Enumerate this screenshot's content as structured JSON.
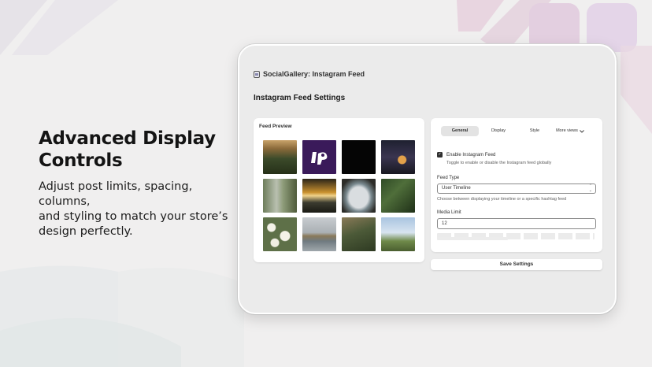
{
  "marketing": {
    "headline_line1": "Advanced Display",
    "headline_line2": "Controls",
    "subcopy_line1": "Adjust post limits, spacing, columns,",
    "subcopy_line2": "and styling to match your store’s",
    "subcopy_line3": "design perfectly."
  },
  "app": {
    "title": "SocialGallery: Instagram Feed",
    "page_title": "Instagram Feed Settings"
  },
  "preview": {
    "label": "Feed Preview",
    "thumbnails": [
      "forest-valley-photo",
      "brand-logo-tile",
      "black-tile",
      "moonrise-photo",
      "waterfall-photo",
      "sunset-lake-photo",
      "coastal-cave-photo",
      "fern-forest-photo",
      "white-flowers-photo",
      "island-village-photo",
      "ruins-photo",
      "lighthouse-photo"
    ]
  },
  "settings": {
    "tabs": [
      "General",
      "Display",
      "Style",
      "More views"
    ],
    "active_tab": "General",
    "enable_label": "Enable Instagram Feed",
    "enable_help": "Toggle to enable or disable the Instagram feed globally",
    "enable_checked": true,
    "feed_type_label": "Feed Type",
    "feed_type_value": "User Timeline",
    "feed_type_help": "Choose between displaying your timeline or a specific hashtag feed",
    "media_limit_label": "Media Limit",
    "media_limit_value": "12",
    "save_label": "Save Settings"
  },
  "colors": {
    "background": "#f0efef",
    "device_frame": "#ffffff",
    "card": "#ffffff",
    "text": "#1c1c1c"
  }
}
